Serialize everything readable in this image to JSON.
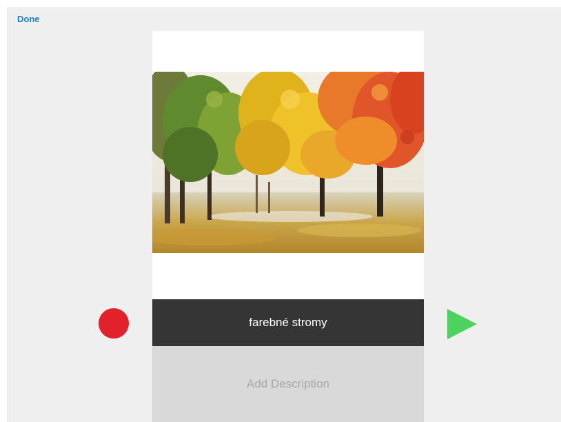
{
  "toolbar": {
    "done_label": "Done"
  },
  "card": {
    "title": "farebné stromy",
    "description_placeholder": "Add Description"
  },
  "icons": {
    "record": "record-icon",
    "play": "play-icon"
  },
  "colors": {
    "accent": "#1a7fd9",
    "record": "#e3212a",
    "play": "#4cd35f",
    "title_bar": "#353535",
    "description_bg": "#d9d9d9",
    "background": "#efefef"
  }
}
